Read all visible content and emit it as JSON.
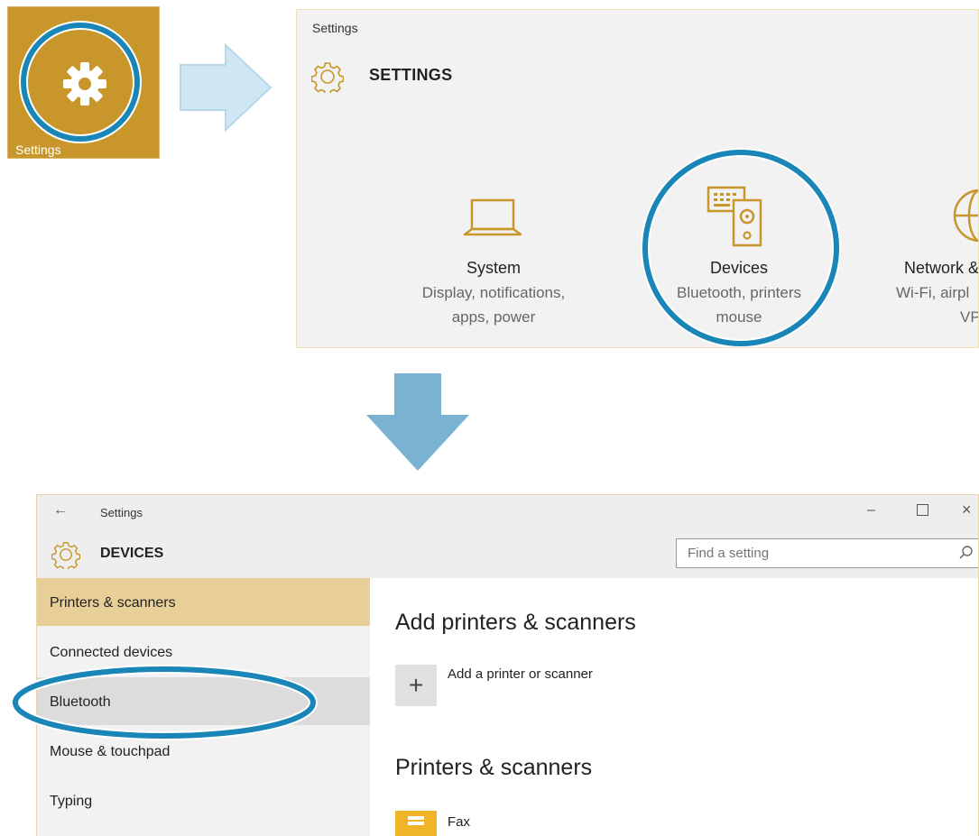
{
  "tile": {
    "label": "Settings",
    "icon": "gear-icon",
    "color": "#c8962a"
  },
  "highlight_color": "#1a86b8",
  "settings_home": {
    "window_title": "Settings",
    "heading": "SETTINGS",
    "categories": [
      {
        "icon": "laptop-icon",
        "name": "System",
        "desc_line1": "Display, notifications,",
        "desc_line2": "apps, power"
      },
      {
        "icon": "devices-icon",
        "name": "Devices",
        "desc_line1": "Bluetooth, printers",
        "desc_line2": "mouse"
      },
      {
        "icon": "globe-icon",
        "name": "Network &",
        "desc_line1": "Wi-Fi, airpl",
        "desc_line2": "VP"
      }
    ]
  },
  "devices_window": {
    "window_title": "Settings",
    "heading": "DEVICES",
    "search_placeholder": "Find a setting",
    "nav": [
      {
        "label": "Printers & scanners",
        "state": "selected"
      },
      {
        "label": "Connected devices",
        "state": "normal"
      },
      {
        "label": "Bluetooth",
        "state": "hover"
      },
      {
        "label": "Mouse & touchpad",
        "state": "normal"
      },
      {
        "label": "Typing",
        "state": "normal"
      }
    ],
    "content": {
      "add_heading": "Add printers & scanners",
      "add_button_label": "Add a printer or scanner",
      "list_heading": "Printers & scanners",
      "devices": [
        {
          "name": "Fax",
          "icon": "printer-icon"
        }
      ]
    }
  }
}
